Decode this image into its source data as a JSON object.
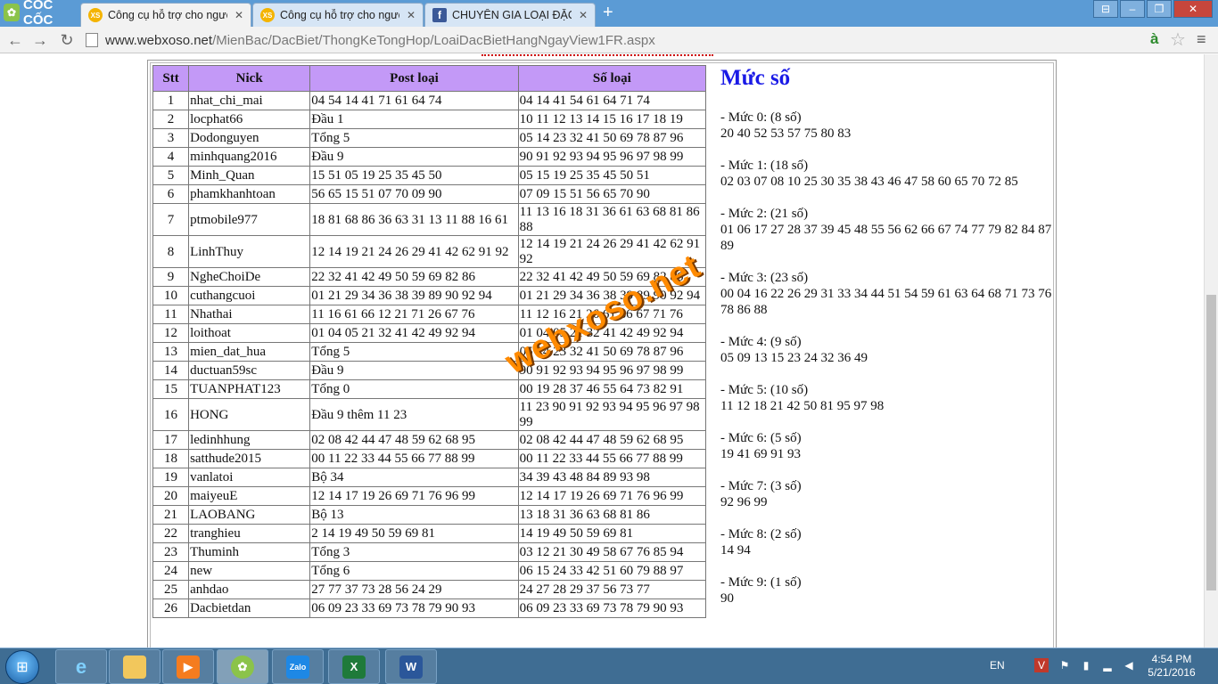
{
  "browser": {
    "brand": "CỐC CỐC",
    "tabs": [
      {
        "title": "Công cụ hỗ trợ cho người",
        "icon": "xs-favicon",
        "active": true
      },
      {
        "title": "Công cụ hỗ trợ cho người",
        "icon": "xs-favicon",
        "active": false
      },
      {
        "title": "CHUYÊN GIA LOẠI ĐẶC BI",
        "icon": "facebook-favicon",
        "active": false
      }
    ],
    "url_domain": "www.webxoso.net",
    "url_path": "/MienBac/DacBiet/ThongKeTongHop/LoaiDacBietHangNgayView1FR.aspx"
  },
  "table": {
    "headers": {
      "stt": "Stt",
      "nick": "Nick",
      "post": "Post loại",
      "so": "Số loại"
    },
    "rows": [
      {
        "stt": "1",
        "nick": "nhat_chi_mai",
        "post": "04 54 14 41 71 61 64 74",
        "so": "04 14 41 54 61 64 71 74"
      },
      {
        "stt": "2",
        "nick": "locphat66",
        "post": "Đầu 1",
        "so": "10 11 12 13 14 15 16 17 18 19"
      },
      {
        "stt": "3",
        "nick": "Dodonguyen",
        "post": "Tổng 5",
        "so": "05 14 23 32 41 50 69 78 87 96"
      },
      {
        "stt": "4",
        "nick": "minhquang2016",
        "post": "Đầu 9",
        "so": "90 91 92 93 94 95 96 97 98 99"
      },
      {
        "stt": "5",
        "nick": "Minh_Quan",
        "post": "15 51 05 19 25 35 45 50",
        "so": "05 15 19 25 35 45 50 51"
      },
      {
        "stt": "6",
        "nick": "phamkhanhtoan",
        "post": "56 65 15 51 07 70 09 90",
        "so": "07 09 15 51 56 65 70 90"
      },
      {
        "stt": "7",
        "nick": "ptmobile977",
        "post": "18 81 68 86 36 63 31 13 11 88 16 61",
        "so": "11 13 16 18 31 36 61 63 68 81 86 88"
      },
      {
        "stt": "8",
        "nick": "LinhThuy",
        "post": "12 14 19 21 24 26 29 41 42 62 91 92",
        "so": "12 14 19 21 24 26 29 41 42 62 91 92"
      },
      {
        "stt": "9",
        "nick": "NgheChoiDe",
        "post": "22 32 41 42 49 50 59 69 82 86",
        "so": "22 32 41 42 49 50 59 69 82 86"
      },
      {
        "stt": "10",
        "nick": "cuthangcuoi",
        "post": "01 21 29 34 36 38 39 89 90 92 94",
        "so": "01 21 29 34 36 38 39 89 90 92 94"
      },
      {
        "stt": "11",
        "nick": "Nhathai",
        "post": "11 16 61 66 12 21 71 26 67 76",
        "so": "11 12 16 21 26 61 66 67 71 76"
      },
      {
        "stt": "12",
        "nick": "loithoat",
        "post": "01 04 05 21 32 41 42 49 92 94",
        "so": "01 04 05 21 32 41 42 49 92 94"
      },
      {
        "stt": "13",
        "nick": "mien_dat_hua",
        "post": "Tổng 5",
        "so": "05 14 23 32 41 50 69 78 87 96"
      },
      {
        "stt": "14",
        "nick": "ductuan59sc",
        "post": "Đầu 9",
        "so": "90 91 92 93 94 95 96 97 98 99"
      },
      {
        "stt": "15",
        "nick": "TUANPHAT123",
        "post": "Tổng 0",
        "so": "00 19 28 37 46 55 64 73 82 91"
      },
      {
        "stt": "16",
        "nick": "HONG",
        "post": "Đầu 9 thêm 11 23",
        "so": "11 23 90 91 92 93 94 95 96 97 98 99"
      },
      {
        "stt": "17",
        "nick": "ledinhhung",
        "post": "02 08 42 44 47 48 59 62 68 95",
        "so": "02 08 42 44 47 48 59 62 68 95"
      },
      {
        "stt": "18",
        "nick": "satthude2015",
        "post": "00 11 22 33 44 55 66 77 88 99",
        "so": "00 11 22 33 44 55 66 77 88 99"
      },
      {
        "stt": "19",
        "nick": "vanlatoi",
        "post": "Bộ 34",
        "so": "34 39 43 48 84 89 93 98"
      },
      {
        "stt": "20",
        "nick": "maiyeuE",
        "post": "12 14 17 19 26 69 71 76 96 99",
        "so": "12 14 17 19 26 69 71 76 96 99"
      },
      {
        "stt": "21",
        "nick": "LAOBANG",
        "post": "Bộ 13",
        "so": "13 18 31 36 63 68 81 86"
      },
      {
        "stt": "22",
        "nick": "tranghieu",
        "post": "2 14 19 49 50 59 69 81",
        "so": "14 19 49 50 59 69 81"
      },
      {
        "stt": "23",
        "nick": "Thuminh",
        "post": "Tổng 3",
        "so": "03 12 21 30 49 58 67 76 85 94"
      },
      {
        "stt": "24",
        "nick": "new",
        "post": "Tổng 6",
        "so": "06 15 24 33 42 51 60 79 88 97"
      },
      {
        "stt": "25",
        "nick": "anhdao",
        "post": "27 77 37 73 28 56 24 29",
        "so": "24 27 28 29 37 56 73 77"
      },
      {
        "stt": "26",
        "nick": "Dacbietdan",
        "post": "06 09 23 33 69 73 78 79 90 93",
        "so": "06 09 23 33 69 73 78 79 90 93"
      }
    ]
  },
  "muc": {
    "title": "Mức số",
    "levels": [
      {
        "label": "- Mức 0: (8 số)",
        "numbers": "20 40 52 53 57 75 80 83"
      },
      {
        "label": "- Mức 1: (18 số)",
        "numbers": "02 03 07 08 10 25 30 35 38 43 46 47 58 60 65 70 72 85"
      },
      {
        "label": "- Mức 2: (21 số)",
        "numbers": "01 06 17 27 28 37 39 45 48 55 56 62 66 67 74 77 79 82 84 87 89"
      },
      {
        "label": "- Mức 3: (23 số)",
        "numbers": "00 04 16 22 26 29 31 33 34 44 51 54 59 61 63 64 68 71 73 76 78 86 88"
      },
      {
        "label": "- Mức 4: (9 số)",
        "numbers": "05 09 13 15 23 24 32 36 49"
      },
      {
        "label": "- Mức 5: (10 số)",
        "numbers": "11 12 18 21 42 50 81 95 97 98"
      },
      {
        "label": "- Mức 6: (5 số)",
        "numbers": "19 41 69 91 93"
      },
      {
        "label": "- Mức 7: (3 số)",
        "numbers": "92 96 99"
      },
      {
        "label": "- Mức 8: (2 số)",
        "numbers": "14 94"
      },
      {
        "label": "- Mức 9: (1 số)",
        "numbers": "90"
      }
    ]
  },
  "watermark": "webxoso.net",
  "taskbar": {
    "lang": "EN",
    "time": "4:54 PM",
    "date": "5/21/2016"
  }
}
